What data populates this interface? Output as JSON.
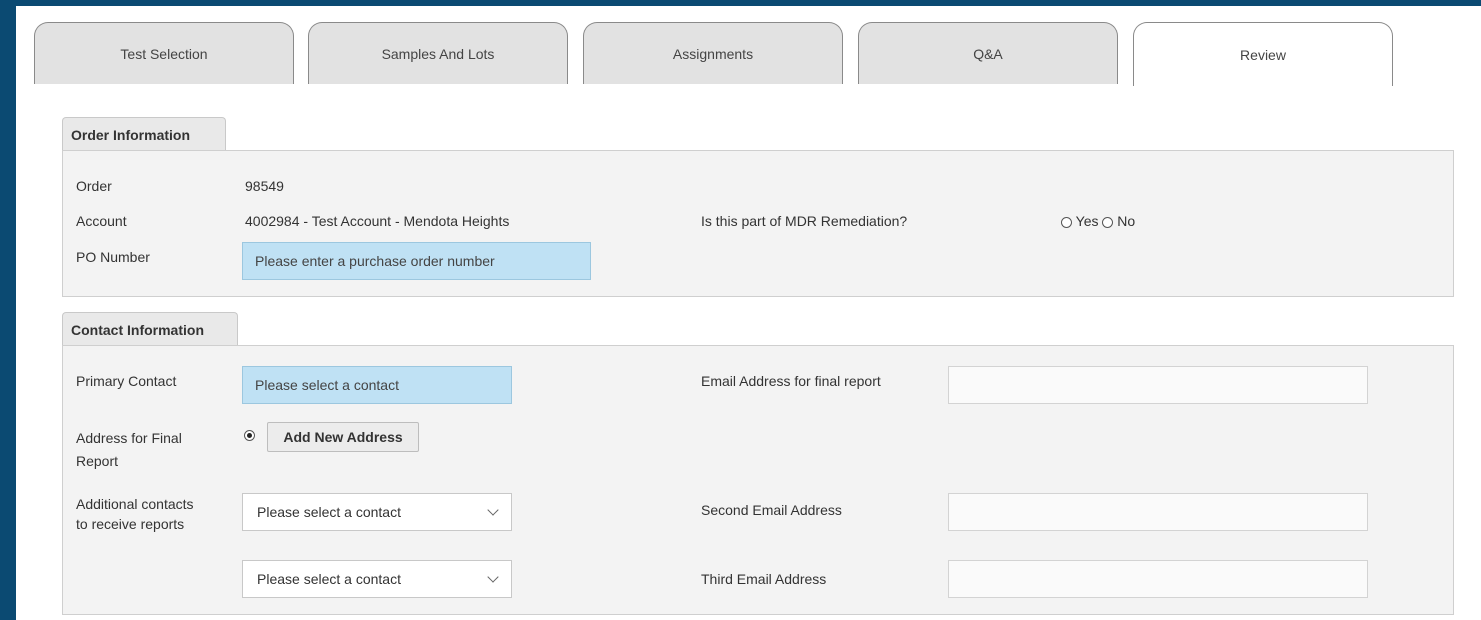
{
  "tabs": [
    {
      "label": "Test Selection"
    },
    {
      "label": "Samples And Lots"
    },
    {
      "label": "Assignments"
    },
    {
      "label": "Q&A"
    },
    {
      "label": "Review",
      "active": true
    }
  ],
  "order_info": {
    "section_title": "Order Information",
    "order_label": "Order",
    "order_value": "98549",
    "account_label": "Account",
    "account_value": "4002984 - Test Account - Mendota Heights",
    "po_label": "PO Number",
    "po_placeholder": "Please enter a purchase order number",
    "mdr_question": "Is this part of MDR Remediation?",
    "mdr_yes": "Yes",
    "mdr_no": "No"
  },
  "contact_info": {
    "section_title": "Contact Information",
    "primary_label": "Primary Contact",
    "primary_value": "Please select a contact",
    "email_final_label": "Email Address for final report",
    "address_label_1": "Address for Final",
    "address_label_2": "Report",
    "add_address_button": "Add New Address",
    "additional_label_1": "Additional contacts",
    "additional_label_2": "to receive reports",
    "additional_select_1": "Please select a contact",
    "additional_select_2": "Please select a contact",
    "second_email_label": "Second Email Address",
    "third_email_label": "Third Email Address"
  }
}
